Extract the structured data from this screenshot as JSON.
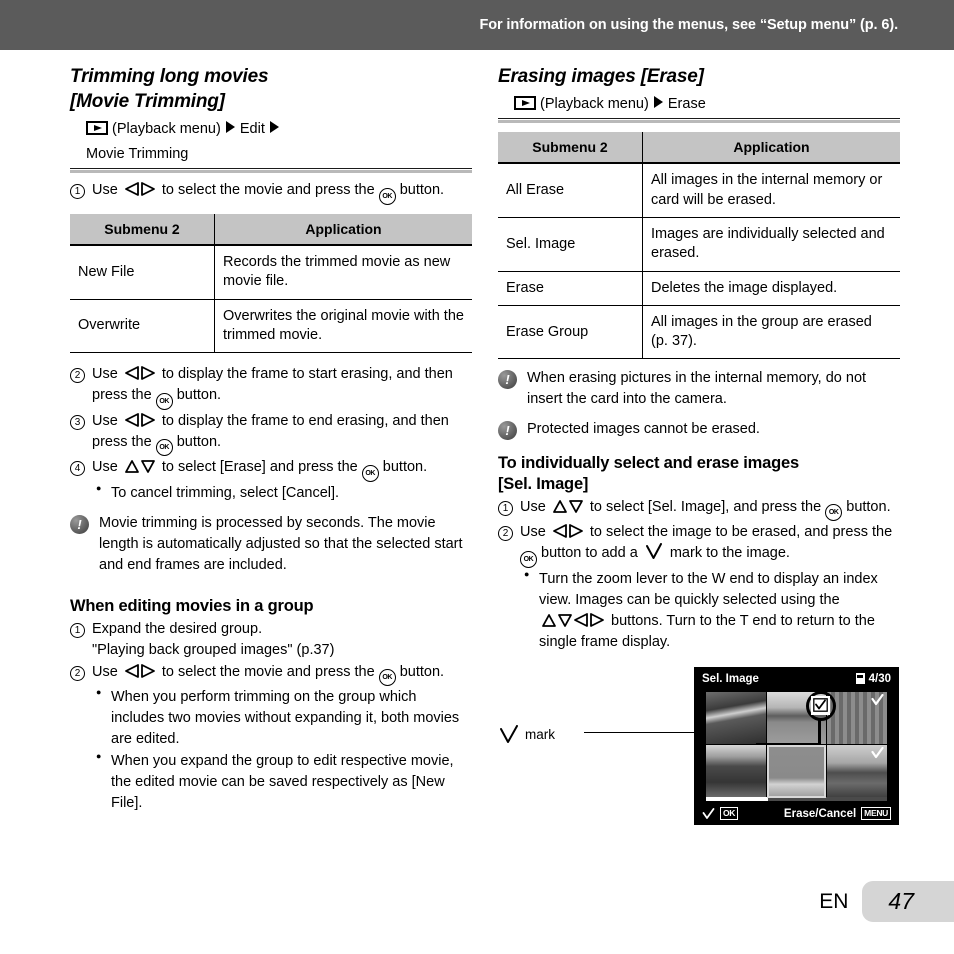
{
  "header": {
    "notice": "For information on using the menus, see “Setup menu” (p. 6)."
  },
  "left_column": {
    "section_title_line1": "Trimming long movies",
    "section_title_line2": "[Movie Trimming]",
    "breadcrumb_line1": "(Playback menu)",
    "breadcrumb_edit": "Edit",
    "breadcrumb_line2": "Movie Trimming",
    "step1_pre": "Use",
    "step1_post": "to select the movie and press the",
    "step1_end": "button.",
    "table": {
      "headers": [
        "Submenu 2",
        "Application"
      ],
      "rows": [
        [
          "New File",
          "Records the trimmed movie as new movie file."
        ],
        [
          "Overwrite",
          "Overwrites the original movie with the trimmed movie."
        ]
      ]
    },
    "step2_pre": "Use",
    "step2_mid": "to display the frame to start erasing, and then press the",
    "step2_end": "button.",
    "step3_pre": "Use",
    "step3_mid": "to display the frame to end erasing, and then press the",
    "step3_end": "button.",
    "step4_pre": "Use",
    "step4_mid": "to select [Erase] and press the",
    "step4_end": "button.",
    "step4_bullet": "To cancel trimming, select [Cancel].",
    "note1": "Movie trimming is processed by seconds. The movie length is automatically adjusted so that the selected start and end frames are included.",
    "group_heading": "When editing movies in a group",
    "group_step1": "Expand the desired group.",
    "group_step1_ref": "\"Playing back grouped images\" (p.37)",
    "group_step2_pre": "Use",
    "group_step2_mid": "to select the movie and press the",
    "group_step2_end": "button.",
    "group_bullets": [
      "When you perform trimming on the group which includes two movies without expanding it, both movies are edited.",
      "When you expand the group to edit respective movie, the edited movie can be saved respectively as [New File]."
    ]
  },
  "right_column": {
    "section_title": "Erasing images [Erase]",
    "breadcrumb_playback": "(Playback menu)",
    "breadcrumb_erase": "Erase",
    "table": {
      "headers": [
        "Submenu 2",
        "Application"
      ],
      "rows": [
        [
          "All Erase",
          "All images in the internal memory or card will be erased."
        ],
        [
          "Sel. Image",
          "Images are individually selected and erased."
        ],
        [
          "Erase",
          "Deletes the image displayed."
        ],
        [
          "Erase Group",
          "All images in the group are erased (p. 37)."
        ]
      ]
    },
    "note1": "When erasing pictures in the internal memory, do not insert the card into the camera.",
    "note2": "Protected images cannot be erased.",
    "sel_heading_line1": "To individually select and erase images",
    "sel_heading_line2": "[Sel. Image]",
    "sel_step1_pre": "Use",
    "sel_step1_mid": "to select [Sel. Image], and press the",
    "sel_step1_end": "button.",
    "sel_step2_pre": "Use",
    "sel_step2_mid": "to select the image to be erased, and press the",
    "sel_step2_mid2": "button to add a",
    "sel_step2_end": "mark to the image.",
    "sel_bullet_part1": "Turn the zoom lever to the W end to display an index view. Images can be quickly selected using the",
    "sel_bullet_part2": "buttons. Turn to the T end to return to the single frame display.",
    "callout_label": "mark"
  },
  "lcd_screen": {
    "title": "Sel. Image",
    "counter": "4/30",
    "ok_label": "OK",
    "action_label": "Erase/Cancel",
    "menu_label": "MENU"
  },
  "footer": {
    "language": "EN",
    "page_number": "47"
  }
}
